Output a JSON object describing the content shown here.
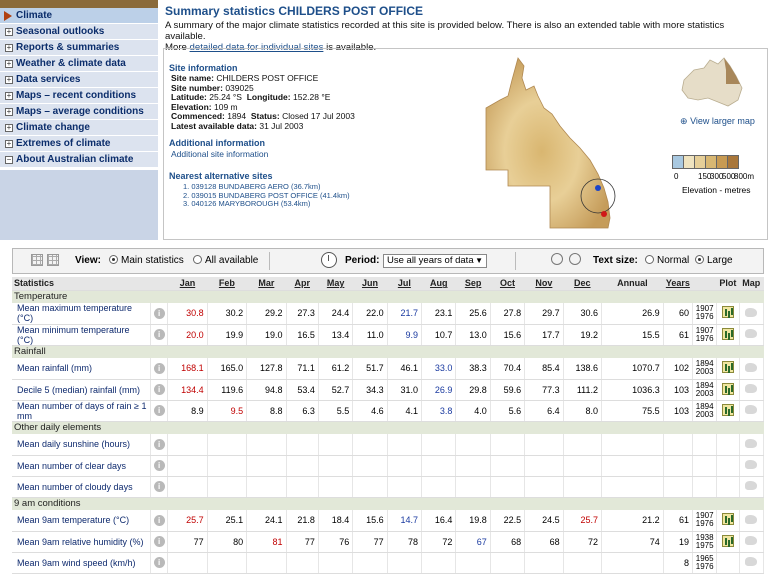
{
  "nav": {
    "items": [
      {
        "label": "Climate",
        "active": true
      },
      {
        "label": "Seasonal outlooks",
        "icon": "plus-icon"
      },
      {
        "label": "Reports & summaries",
        "icon": "plus-icon"
      },
      {
        "label": "Weather & climate data",
        "icon": "plus-icon"
      },
      {
        "label": "Data services",
        "icon": "plus-icon"
      },
      {
        "label": "Maps – recent conditions",
        "icon": "plus-icon"
      },
      {
        "label": "Maps – average conditions",
        "icon": "plus-icon"
      },
      {
        "label": "Climate change",
        "icon": "plus-icon"
      },
      {
        "label": "Extremes of climate",
        "icon": "plus-icon"
      },
      {
        "label": "About Australian climate",
        "icon": "minus-icon"
      }
    ]
  },
  "page": {
    "title": "Summary statistics CHILDERS POST OFFICE",
    "summary_1": "A summary of the major climate statistics recorded at this site is provided below. There is also an extended table with more statistics available.",
    "summary_2a": "More",
    "summary_link": "detailed data for individual sites",
    "summary_2b": "is available."
  },
  "site": {
    "heading": "Site information",
    "name_label": "Site name:",
    "name": "CHILDERS POST OFFICE",
    "number_label": "Site number:",
    "number": "039025",
    "lat_label": "Latitude:",
    "lat": "25.24 °S",
    "lon_label": "Longitude:",
    "lon": "152.28 °E",
    "elev_label": "Elevation:",
    "elev": "109 m",
    "comm_label": "Commenced:",
    "comm": "1894",
    "status_label": "Status:",
    "status": "Closed 17 Jul 2003",
    "latest_label": "Latest available data:",
    "latest": "31 Jul 2003",
    "additional_heading": "Additional information",
    "additional_link": "Additional site information",
    "nearest_heading": "Nearest alternative sites",
    "alts": [
      "1. 039128   BUNDABERG AERO (36.7km)",
      "2. 039015   BUNDABERG POST OFFICE (41.4km)",
      "3. 040126   MARYBOROUGH (53.4km)"
    ],
    "view_larger_map": "View larger map"
  },
  "legend": {
    "ticks": [
      "0",
      "150",
      "300",
      "500",
      "800m"
    ],
    "caption": "Elevation - metres",
    "colors": [
      "#a8c8e0",
      "#efe3bf",
      "#e6cf98",
      "#d8b772",
      "#c79a52",
      "#a9773a"
    ]
  },
  "toolbar": {
    "view_label": "View:",
    "view_main": "Main statistics",
    "view_all": "All available",
    "period_label": "Period:",
    "period_value": "Use all years of data",
    "text_size_label": "Text size:",
    "size_normal": "Normal",
    "size_large": "Large"
  },
  "table": {
    "header": {
      "statistics": "Statistics",
      "months": [
        "Jan",
        "Feb",
        "Mar",
        "Apr",
        "May",
        "Jun",
        "Jul",
        "Aug",
        "Sep",
        "Oct",
        "Nov",
        "Dec"
      ],
      "annual": "Annual",
      "years": "Years",
      "plot": "Plot",
      "map": "Map"
    },
    "groups": [
      {
        "name": "Temperature",
        "rows": [
          {
            "label": "Mean maximum temperature (°C)",
            "values": [
              "30.8",
              "30.2",
              "29.2",
              "27.3",
              "24.4",
              "22.0",
              "21.7",
              "23.1",
              "25.6",
              "27.8",
              "29.7",
              "30.6"
            ],
            "annual": "26.9",
            "years": "60",
            "yr1": "1907",
            "yr2": "1976",
            "plot": true
          },
          {
            "label": "Mean minimum temperature (°C)",
            "values": [
              "20.0",
              "19.9",
              "19.0",
              "16.5",
              "13.4",
              "11.0",
              "9.9",
              "10.7",
              "13.0",
              "15.6",
              "17.7",
              "19.2"
            ],
            "annual": "15.5",
            "years": "61",
            "yr1": "1907",
            "yr2": "1976",
            "plot": true
          }
        ]
      },
      {
        "name": "Rainfall",
        "rows": [
          {
            "label": "Mean rainfall (mm)",
            "values": [
              "168.1",
              "165.0",
              "127.8",
              "71.1",
              "61.2",
              "51.7",
              "46.1",
              "33.0",
              "38.3",
              "70.4",
              "85.4",
              "138.6"
            ],
            "annual": "1070.7",
            "years": "102",
            "yr1": "1894",
            "yr2": "2003",
            "plot": true
          },
          {
            "label": "Decile 5 (median) rainfall (mm)",
            "values": [
              "134.4",
              "119.6",
              "94.8",
              "53.4",
              "52.7",
              "34.3",
              "31.0",
              "26.9",
              "29.8",
              "59.6",
              "77.3",
              "111.2"
            ],
            "annual": "1036.3",
            "years": "103",
            "yr1": "1894",
            "yr2": "2003",
            "plot": true
          },
          {
            "label": "Mean number of days of rain ≥ 1 mm",
            "values": [
              "8.9",
              "9.5",
              "8.8",
              "6.3",
              "5.5",
              "4.6",
              "4.1",
              "3.8",
              "4.0",
              "5.6",
              "6.4",
              "8.0"
            ],
            "annual": "75.5",
            "years": "103",
            "yr1": "1894",
            "yr2": "2003",
            "plot": true
          }
        ]
      },
      {
        "name": "Other daily elements",
        "rows": [
          {
            "label": "Mean daily sunshine (hours)",
            "values": [
              "",
              "",
              "",
              "",
              "",
              "",
              "",
              "",
              "",
              "",
              "",
              ""
            ],
            "annual": "",
            "years": "",
            "yr1": "",
            "yr2": "",
            "plot": false
          },
          {
            "label": "Mean number of clear days",
            "values": [
              "",
              "",
              "",
              "",
              "",
              "",
              "",
              "",
              "",
              "",
              "",
              ""
            ],
            "annual": "",
            "years": "",
            "yr1": "",
            "yr2": "",
            "plot": false
          },
          {
            "label": "Mean number of cloudy days",
            "values": [
              "",
              "",
              "",
              "",
              "",
              "",
              "",
              "",
              "",
              "",
              "",
              ""
            ],
            "annual": "",
            "years": "",
            "yr1": "",
            "yr2": "",
            "plot": false
          }
        ]
      },
      {
        "name": "9 am conditions",
        "rows": [
          {
            "label": "Mean 9am temperature (°C)",
            "values": [
              "25.7",
              "25.1",
              "24.1",
              "21.8",
              "18.4",
              "15.6",
              "14.7",
              "16.4",
              "19.8",
              "22.5",
              "24.5",
              "25.7"
            ],
            "annual": "21.2",
            "years": "61",
            "yr1": "1907",
            "yr2": "1976",
            "plot": true
          },
          {
            "label": "Mean 9am relative humidity (%)",
            "values": [
              "77",
              "80",
              "81",
              "77",
              "76",
              "77",
              "78",
              "72",
              "67",
              "68",
              "68",
              "72"
            ],
            "annual": "74",
            "years": "19",
            "yr1": "1938",
            "yr2": "1975",
            "plot": true
          },
          {
            "label": "Mean 9am wind speed (km/h)",
            "values": [
              "",
              "",
              "",
              "",
              "",
              "",
              "",
              "",
              "",
              "",
              "",
              ""
            ],
            "annual": "",
            "years": "8",
            "yr1": "1965",
            "yr2": "1976",
            "plot": false
          }
        ]
      }
    ]
  }
}
